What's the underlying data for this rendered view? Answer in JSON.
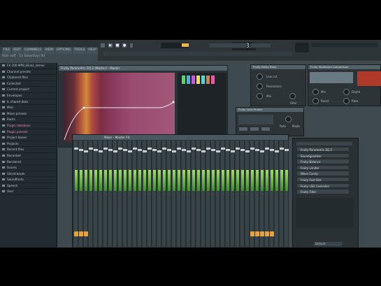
{
  "window": {
    "title": "FL Studio"
  },
  "menu": {
    "items": [
      "FILE",
      "EDIT",
      "CHANNELS",
      "VIEW",
      "OPTIONS",
      "TOOLS",
      "HELP"
    ]
  },
  "hint_bar": {
    "text": "Rain soft - 11 Saturdays 00"
  },
  "transport": {
    "time_display": "0:43",
    "time_frac": "22",
    "tempo": ""
  },
  "browser": {
    "rows": [
      {
        "label": "FX 100 MPB_Bluez_stereo",
        "pink": false
      },
      {
        "label": "Channel presets",
        "pink": false
      },
      {
        "label": "Clipboard files",
        "pink": false
      },
      {
        "label": "Collected",
        "pink": false
      },
      {
        "label": "Current project",
        "pink": false
      },
      {
        "label": "Envelopes",
        "pink": false
      },
      {
        "label": "IL shared data",
        "pink": false
      },
      {
        "label": "Misc",
        "pink": false
      },
      {
        "label": "Mixer presets",
        "pink": false
      },
      {
        "label": "Packs",
        "pink": false
      },
      {
        "label": "Plugin database",
        "pink": true
      },
      {
        "label": "Plugin presets",
        "pink": true
      },
      {
        "label": "Project bones",
        "pink": false
      },
      {
        "label": "Projects",
        "pink": false
      },
      {
        "label": "Recent files",
        "pink": false
      },
      {
        "label": "Recorded",
        "pink": false
      },
      {
        "label": "Rendered",
        "pink": false
      },
      {
        "label": "Scores",
        "pink": false
      },
      {
        "label": "Sliced beats",
        "pink": false
      },
      {
        "label": "Soundfonts",
        "pink": false
      },
      {
        "label": "Speech",
        "pink": false
      },
      {
        "label": "User",
        "pink": false
      }
    ]
  },
  "playlist": {
    "title": "Fruity Parametric EQ 2 (Master) - Master"
  },
  "mixer": {
    "title": "Mixer - Master FX"
  },
  "fx_slots": [
    "Fruity Parametric EQ 2",
    "Soundgoodizer",
    "Fruity Balance",
    "Fruity Limiter",
    "Wave Candy",
    "Fruity Fast Dist",
    "Fruity LSD Controller",
    "Fruity Filter"
  ],
  "fx_bottom": {
    "label": "Default"
  },
  "knob_panel": {
    "title": "Fruity Delay Bank",
    "labels": [
      "Low cut",
      "Resonance",
      "Mix",
      "Filter"
    ]
  },
  "knob_panel2": {
    "title": "Fruity Multiband Compressor",
    "labels": [
      "Mix",
      "Boost",
      "Depth",
      "Rate"
    ]
  },
  "delay_panel": {
    "title": "Fruity Love Philter",
    "labels": [
      "Rate",
      "Mode"
    ]
  },
  "colors": {
    "accent": "#e6a33a",
    "meter": "#7fcf4a",
    "pink_text": "#e08ab2",
    "bg": "#3f4a50"
  }
}
